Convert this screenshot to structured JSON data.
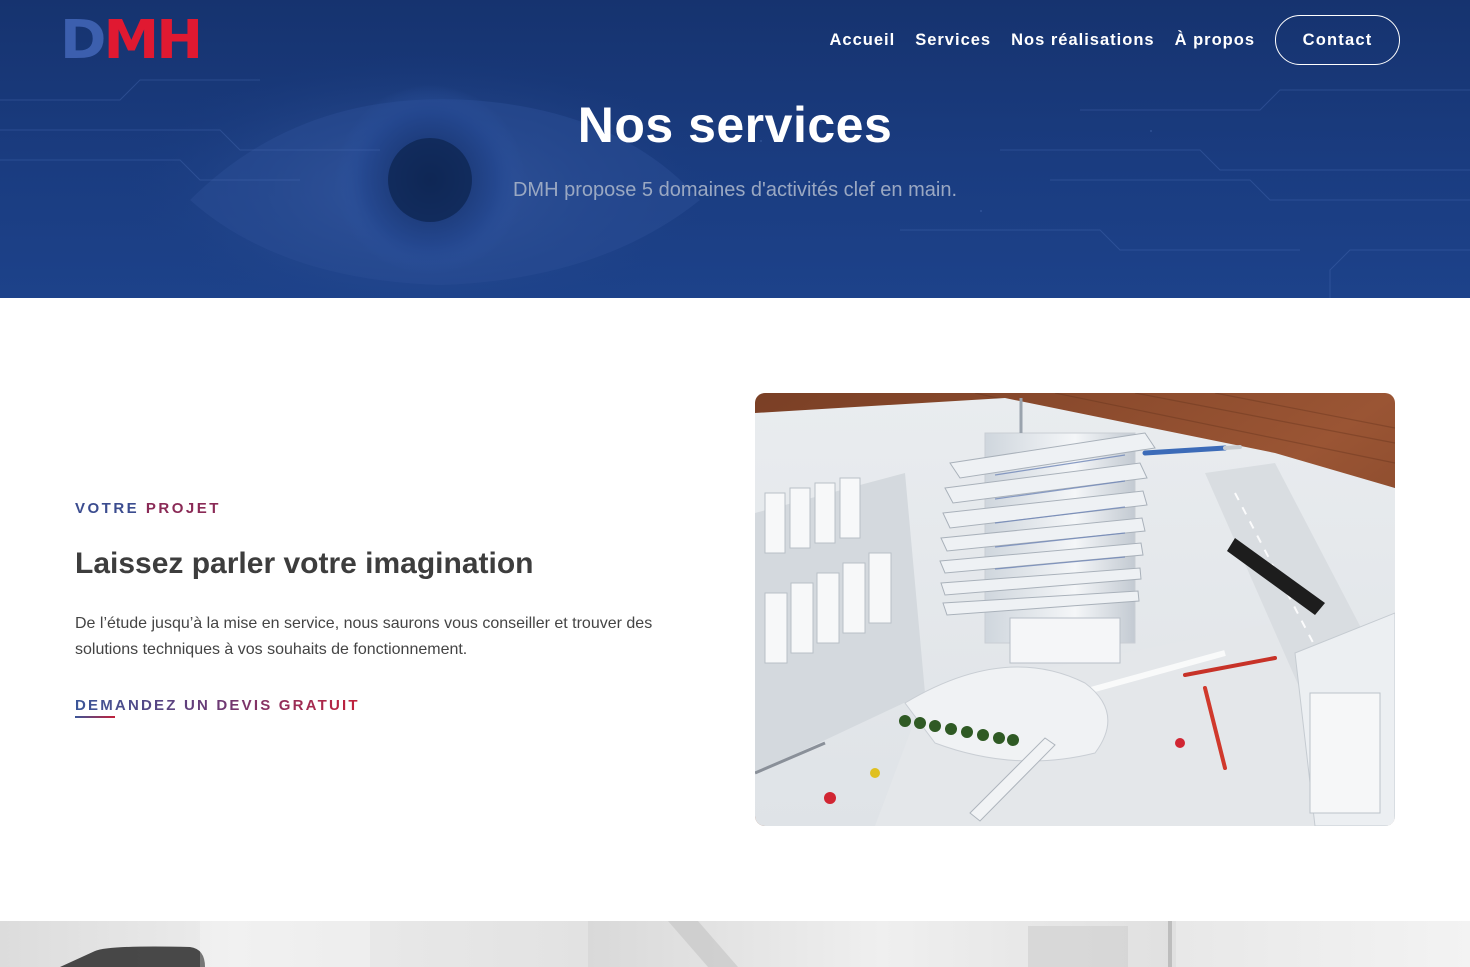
{
  "header": {
    "logo": {
      "part1": "D",
      "part2": "MH"
    },
    "nav": [
      {
        "label": "Accueil"
      },
      {
        "label": "Services"
      },
      {
        "label": "Nos réalisations"
      },
      {
        "label": "À propos"
      }
    ],
    "contact_label": "Contact"
  },
  "hero": {
    "title": "Nos services",
    "subtitle": "DMH propose 5 domaines d'activités clef en main."
  },
  "section": {
    "kicker_part1": "VOTRE",
    "kicker_part2": "PROJET",
    "heading": "Laissez parler votre imagination",
    "text": "De l’étude jusqu’à la mise en service, nous saurons vous conseiller et trouver des solutions techniques à vos souhaits de fonctionnement.",
    "cta_label": "DEMANDEZ UN DEVIS GRATUIT"
  },
  "colors": {
    "hero_blue": "#1a3c80",
    "logo_blue": "#3c5fae",
    "logo_red": "#e01931",
    "accent_blue": "#3b4c8f",
    "accent_red": "#c2203a"
  }
}
